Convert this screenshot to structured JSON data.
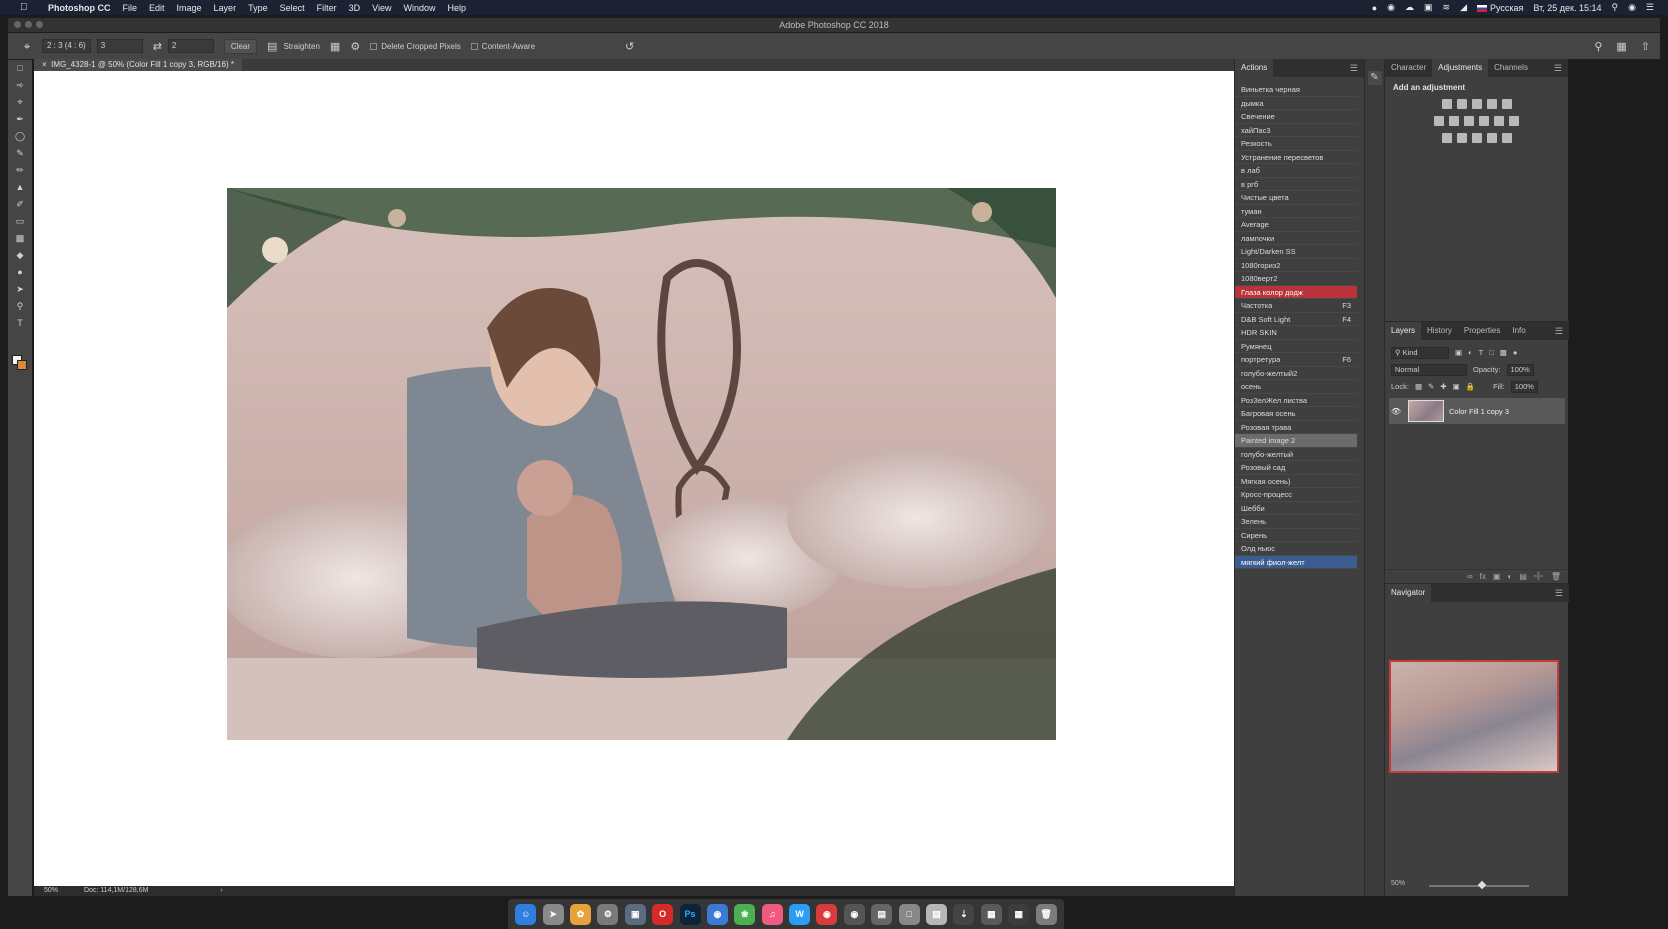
{
  "menubar": {
    "app": "Photoshop CC",
    "items": [
      "File",
      "Edit",
      "Image",
      "Layer",
      "Type",
      "Select",
      "Filter",
      "3D",
      "View",
      "Window",
      "Help"
    ],
    "lang": "Русская",
    "clock": "Вт, 25 дек.  15:14"
  },
  "window": {
    "title": "Adobe Photoshop CC 2018"
  },
  "options": {
    "ratio_select": "2 : 3 (4 : 6)",
    "width": "3",
    "height": "2",
    "clear": "Clear",
    "straighten": "Straighten",
    "delete_cropped": "Delete Cropped Pixels",
    "content_aware": "Content-Aware"
  },
  "document": {
    "tab": "IMG_4328-1 @ 50% (Color Fill 1 copy 3, RGB/16) *",
    "zoom": "50%",
    "doc_info": "Doc: 114,1M/128,6M"
  },
  "actions": {
    "tab": "Actions",
    "items": [
      {
        "name": "Виньетка черная",
        "key": "",
        "state": ""
      },
      {
        "name": "дымка",
        "key": "",
        "state": ""
      },
      {
        "name": "Свечение",
        "key": "",
        "state": ""
      },
      {
        "name": "хайПас3",
        "key": "",
        "state": ""
      },
      {
        "name": "Резкость",
        "key": "",
        "state": ""
      },
      {
        "name": "Устранение пересветов",
        "key": "",
        "state": ""
      },
      {
        "name": "в лаб",
        "key": "",
        "state": ""
      },
      {
        "name": "в ргб",
        "key": "",
        "state": ""
      },
      {
        "name": "Чистые цвета",
        "key": "",
        "state": ""
      },
      {
        "name": "туман",
        "key": "",
        "state": ""
      },
      {
        "name": "Average",
        "key": "",
        "state": ""
      },
      {
        "name": "лампочки",
        "key": "",
        "state": ""
      },
      {
        "name": "Light/Darken SS",
        "key": "",
        "state": ""
      },
      {
        "name": "1080гориз2",
        "key": "",
        "state": ""
      },
      {
        "name": "1080верт2",
        "key": "",
        "state": ""
      },
      {
        "name": "Глаза колор додж",
        "key": "",
        "state": "red"
      },
      {
        "name": "Частотка",
        "key": "F3",
        "state": ""
      },
      {
        "name": "D&B Soft Light",
        "key": "F4",
        "state": ""
      },
      {
        "name": "HDR SKIN",
        "key": "",
        "state": ""
      },
      {
        "name": "Румянец",
        "key": "",
        "state": ""
      },
      {
        "name": "портретура",
        "key": "F6",
        "state": ""
      },
      {
        "name": "голубо-желтый2",
        "key": "",
        "state": ""
      },
      {
        "name": "осень",
        "key": "",
        "state": ""
      },
      {
        "name": "РозЗелЖел листва",
        "key": "",
        "state": ""
      },
      {
        "name": "Багровая осень",
        "key": "",
        "state": ""
      },
      {
        "name": "Розовая трава",
        "key": "",
        "state": ""
      },
      {
        "name": "Painted image 2",
        "key": "",
        "state": "sel"
      },
      {
        "name": "голубо-желтый",
        "key": "",
        "state": ""
      },
      {
        "name": "Розовый сад",
        "key": "",
        "state": ""
      },
      {
        "name": "Мягкая осень)",
        "key": "",
        "state": ""
      },
      {
        "name": "Кросс-процесс",
        "key": "",
        "state": ""
      },
      {
        "name": "Шебби",
        "key": "",
        "state": ""
      },
      {
        "name": "Зелень",
        "key": "",
        "state": ""
      },
      {
        "name": "Сирень",
        "key": "",
        "state": ""
      },
      {
        "name": "Олд ньюс",
        "key": "",
        "state": ""
      },
      {
        "name": "мягкий фиол-желт",
        "key": "",
        "state": "blue"
      }
    ]
  },
  "adjustments": {
    "tabs": [
      "Character",
      "Adjustments",
      "Channels"
    ],
    "title": "Add an adjustment"
  },
  "layers": {
    "tabs": [
      "Layers",
      "History",
      "Properties",
      "Info"
    ],
    "kind": "Kind",
    "blend": "Normal",
    "opacity_label": "Opacity:",
    "opacity": "100%",
    "lock_label": "Lock:",
    "fill_label": "Fill:",
    "fill": "100%",
    "layer_name": "Color Fill 1 copy 3"
  },
  "navigator": {
    "tab": "Navigator",
    "zoom": "50%"
  },
  "colors": {
    "accent_red": "#b8333a",
    "accent_blue": "#3b5c8f"
  }
}
